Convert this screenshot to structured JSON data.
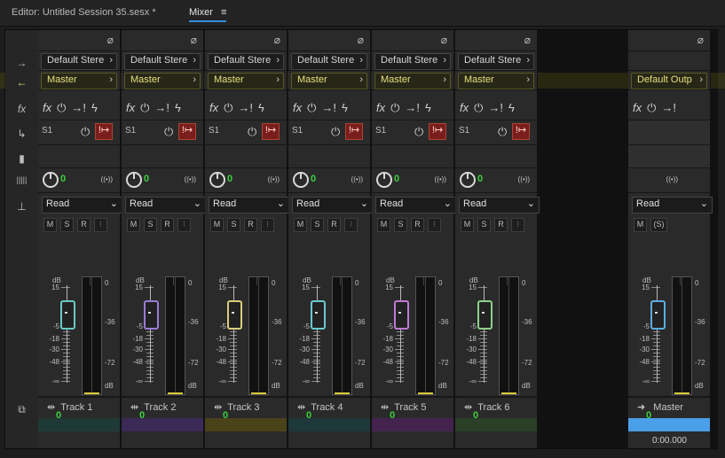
{
  "tabs": [
    {
      "label": "Editor: Untitled Session 35.sesx *"
    },
    {
      "label": "Mixer"
    }
  ],
  "tab_menu_icon": "≡",
  "colors": {
    "accent": "#2f8ee0",
    "value_green": "#3bd23b",
    "master_yellow": "#e6e07a"
  },
  "tracks": [
    {
      "name": "Track 1",
      "input": "Default Stere",
      "output": "Master",
      "automation": "Read",
      "send": "S1",
      "pan": "0",
      "volume": "0",
      "fader_color": "#6bc9c3",
      "color": "#1f3a36"
    },
    {
      "name": "Track 2",
      "input": "Default Stere",
      "output": "Master",
      "automation": "Read",
      "send": "S1",
      "pan": "0",
      "volume": "0",
      "fader_color": "#9b7ad6",
      "color": "#3b2a55"
    },
    {
      "name": "Track 3",
      "input": "Default Stere",
      "output": "Master",
      "automation": "Read",
      "send": "S1",
      "pan": "0",
      "volume": "0",
      "fader_color": "#d8cf7a",
      "color": "#4a431a"
    },
    {
      "name": "Track 4",
      "input": "Default Stere",
      "output": "Master",
      "automation": "Read",
      "send": "S1",
      "pan": "0",
      "volume": "0",
      "fader_color": "#6bc9cf",
      "color": "#1f383a"
    },
    {
      "name": "Track 5",
      "input": "Default Stere",
      "output": "Master",
      "automation": "Read",
      "send": "S1",
      "pan": "0",
      "volume": "0",
      "fader_color": "#c07ad6",
      "color": "#44244f"
    },
    {
      "name": "Track 6",
      "input": "Default Stere",
      "output": "Master",
      "automation": "Read",
      "send": "S1",
      "pan": "0",
      "volume": "0",
      "fader_color": "#8ed08a",
      "color": "#2b3f28"
    }
  ],
  "master": {
    "name": "Master",
    "output": "Default Outp",
    "automation": "Read",
    "volume": "0",
    "fader_color": "#5aaee0",
    "color": "#4a9fe8",
    "stereo": "((•))"
  },
  "buttons": {
    "m": "M",
    "s": "S",
    "r": "R",
    "i": "I",
    "s_solo_master": "(S)"
  },
  "pan_stereo_label": "((•))",
  "fader_scale": {
    "db": "dB",
    "labels": [
      "15",
      "0",
      "-5",
      "-18",
      "-30",
      "-48",
      "-∞"
    ]
  },
  "meter_scale": {
    "labels": [
      "0",
      "-36",
      "-72",
      "dB"
    ]
  },
  "timecode": "0:00.000",
  "row_icons": {
    "input": "→",
    "output": "←",
    "fx": "fx",
    "sends": "↳",
    "eq": "▮",
    "pan": "|||||",
    "vol": "⊥",
    "track": "⧉"
  }
}
